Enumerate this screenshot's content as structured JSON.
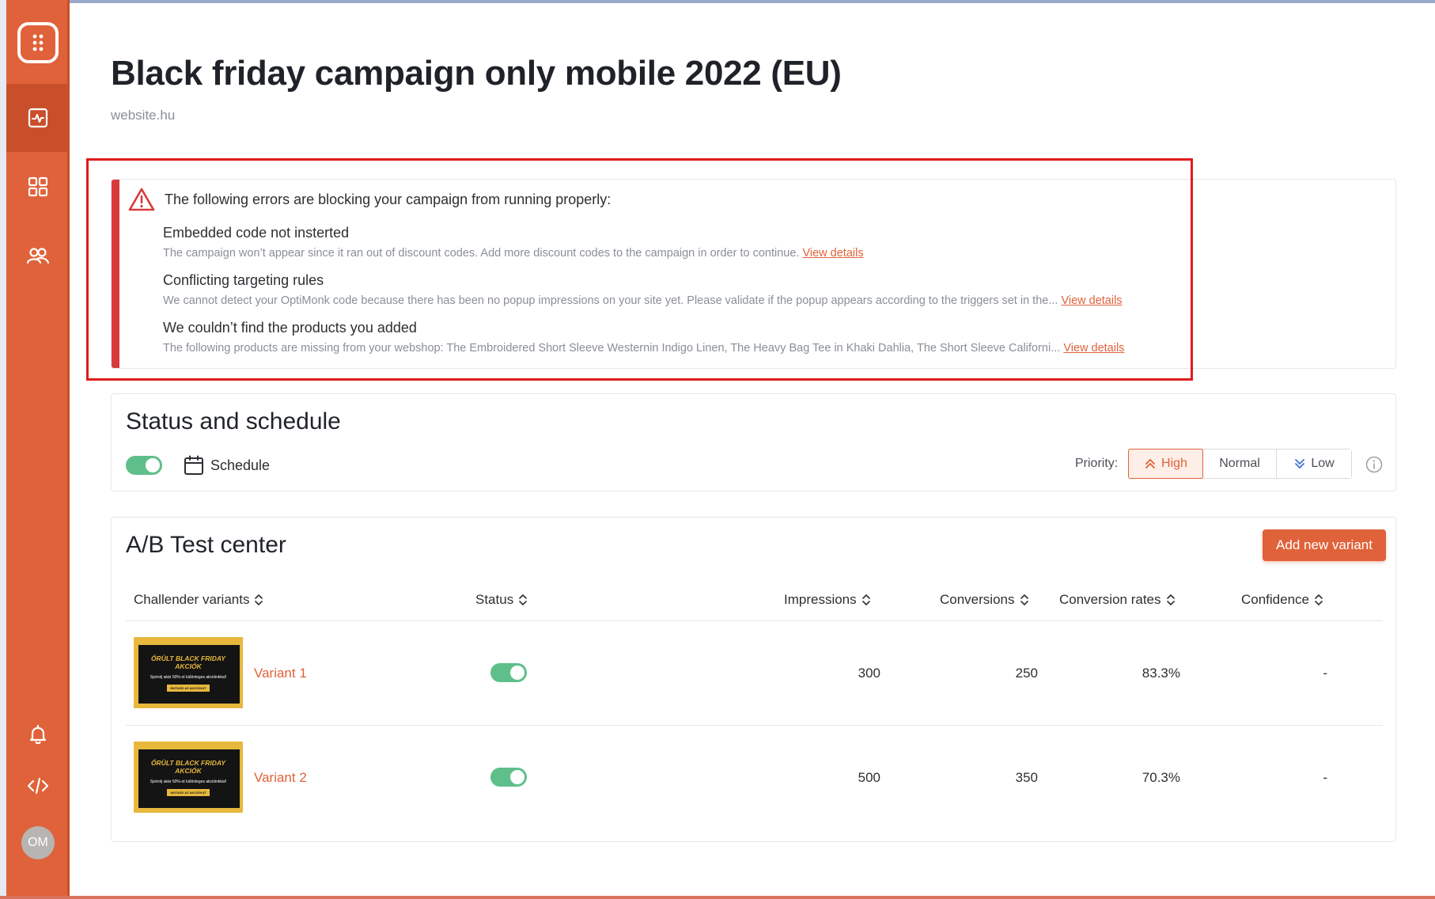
{
  "header": {
    "title": "Black friday campaign only mobile 2022 (EU)",
    "domain": "website.hu"
  },
  "sidebar": {
    "items": [
      {
        "icon": "analytics-icon",
        "active": true
      },
      {
        "icon": "grid-icon",
        "active": false
      },
      {
        "icon": "users-icon",
        "active": false
      }
    ],
    "bottom_items": [
      "bell-icon",
      "code-icon"
    ],
    "avatar_initials": "OM"
  },
  "errors": {
    "heading": "The following errors are blocking your campaign from running properly:",
    "link_label": "View details",
    "items": [
      {
        "title": "Embedded code not insterted",
        "description": "The campaign won’t appear since it ran out of discount codes. Add more discount codes to the campaign in order to continue."
      },
      {
        "title": "Conflicting targeting rules",
        "description": "We cannot detect your OptiMonk code because there has been no popup impressions on your site yet. Please validate if the popup appears according to the triggers set in the..."
      },
      {
        "title": "We couldn’t find the products you added",
        "description": "The following products are missing from your webshop: The Embroidered Short Sleeve Westernin Indigo Linen,  The Heavy Bag Tee in Khaki Dahlia, The Short Sleeve Californi..."
      }
    ]
  },
  "status": {
    "title": "Status and schedule",
    "enabled": true,
    "schedule_label": "Schedule",
    "priority_label": "Priority:",
    "priority_options": [
      "High",
      "Normal",
      "Low"
    ],
    "priority_selected": "High"
  },
  "ab_test": {
    "title": "A/B Test center",
    "add_button": "Add new variant",
    "columns": [
      "Challender variants",
      "Status",
      "Impressions",
      "Conversions",
      "Conversion rates",
      "Confidence"
    ],
    "thumbnail": {
      "headline_1": "ŐRÜLT BLACK FRIDAY",
      "headline_2": "AKCIÓK",
      "subtext": "Spórolj akár 50%-ot különleges akcióinkkal!",
      "cta": "MUTASD AZ AKCIÓKAT"
    },
    "rows": [
      {
        "name": "Variant 1",
        "active": true,
        "impressions": "300",
        "conversions": "250",
        "conversion_rate": "83.3%",
        "confidence": "-"
      },
      {
        "name": "Variant 2",
        "active": true,
        "impressions": "500",
        "conversions": "350",
        "conversion_rate": "70.3%",
        "confidence": "-"
      }
    ]
  },
  "colors": {
    "brand": "#e0623a",
    "error": "#d83a3a",
    "success": "#5fbf8a",
    "annotation": "#e01b1b"
  }
}
